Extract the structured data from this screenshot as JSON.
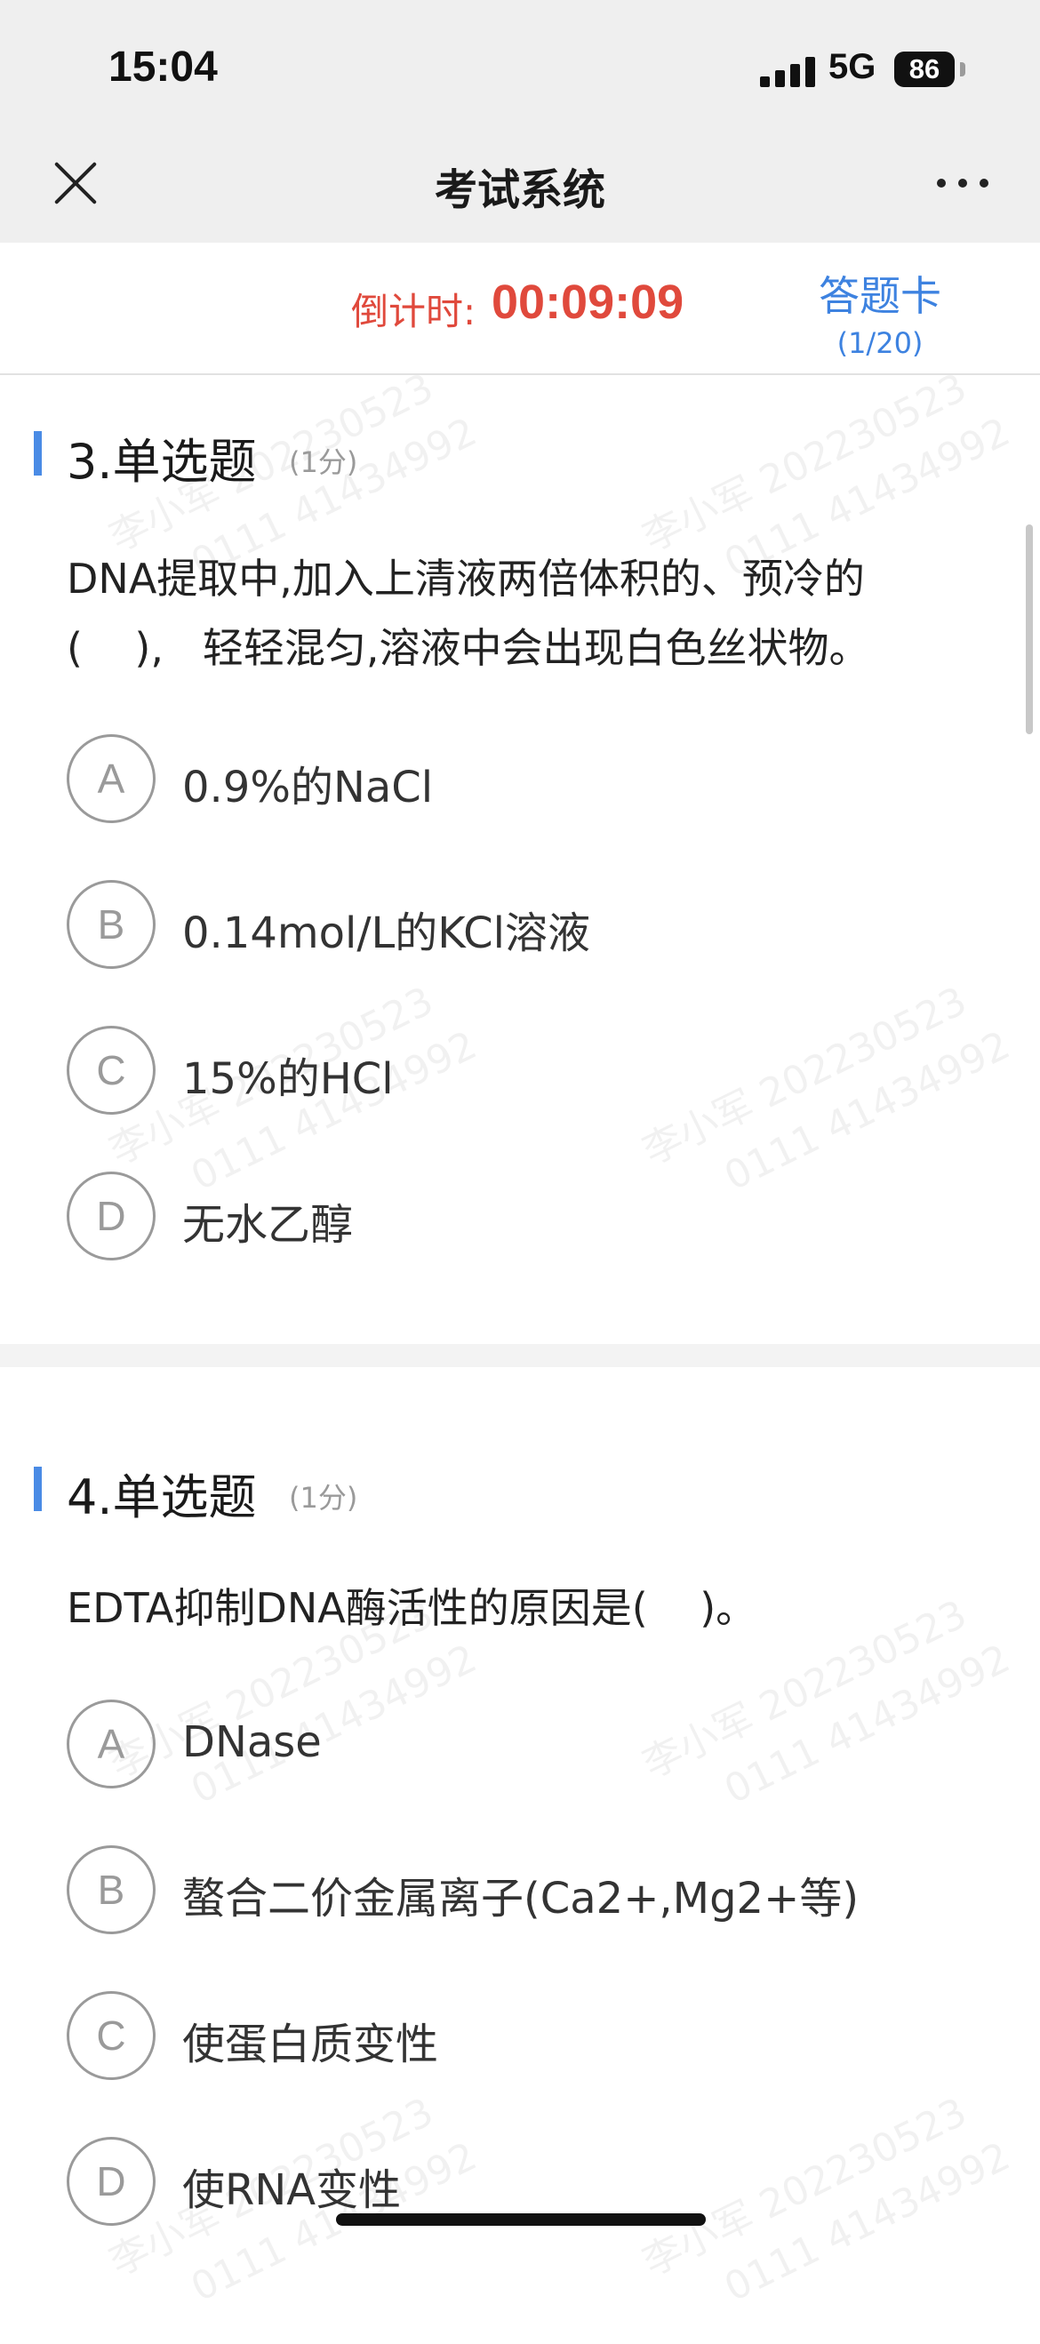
{
  "status_bar": {
    "time": "15:04",
    "network": "5G",
    "battery": "86"
  },
  "nav": {
    "title": "考试系统"
  },
  "timer": {
    "label": "倒计时:",
    "value": "00:09:09",
    "card_label": "答题卡",
    "card_count": "(1/20)"
  },
  "watermark": {
    "line1": "李小军 202230523",
    "line2": "0111 41434992"
  },
  "questions": [
    {
      "title": "3.单选题",
      "score": "(1分)",
      "text_line1": "DNA提取中,加入上清液两倍体积的、预冷的",
      "text_line2": "(    ),   轻轻混匀,溶液中会出现白色丝状物。",
      "options": [
        {
          "letter": "A",
          "text": "0.9%的NaCl"
        },
        {
          "letter": "B",
          "text": "0.14mol/L的KCl溶液"
        },
        {
          "letter": "C",
          "text": "15%的HCl"
        },
        {
          "letter": "D",
          "text": "无水乙醇"
        }
      ]
    },
    {
      "title": "4.单选题",
      "score": "(1分)",
      "text_line1": "EDTA抑制DNA酶活性的原因是(    )。",
      "options": [
        {
          "letter": "A",
          "text": "DNase"
        },
        {
          "letter": "B",
          "text": "螯合二价金属离子(Ca2+,Mg2+等)"
        },
        {
          "letter": "C",
          "text": "使蛋白质变性"
        },
        {
          "letter": "D",
          "text": "使RNA变性"
        }
      ]
    }
  ]
}
